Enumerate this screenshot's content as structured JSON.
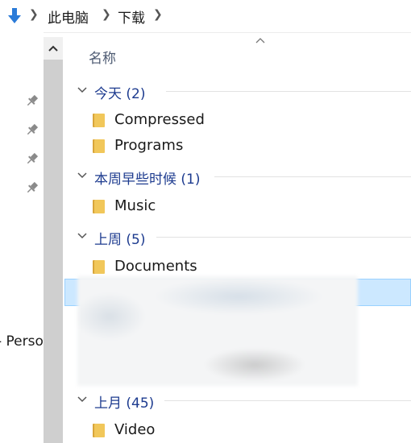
{
  "address": {
    "crumbs": [
      "此电脑",
      "下载"
    ]
  },
  "nav": {
    "partial_label": "- Perso"
  },
  "list": {
    "column_header": "名称",
    "groups": [
      {
        "title": "今天 (2)",
        "items": [
          "Compressed",
          "Programs"
        ]
      },
      {
        "title": "本周早些时候 (1)",
        "items": [
          "Music"
        ]
      },
      {
        "title": "上周 (5)",
        "items": [
          "Documents"
        ]
      },
      {
        "title": "上月 (45)",
        "items": [
          "Video"
        ]
      }
    ]
  },
  "colors": {
    "accent": "#1d3b8f",
    "selection": "#cce8ff",
    "folder": "#e8bd4a"
  },
  "icons": {
    "address": "download-arrow-icon",
    "pin": "pin-icon",
    "folder": "folder-icon"
  }
}
